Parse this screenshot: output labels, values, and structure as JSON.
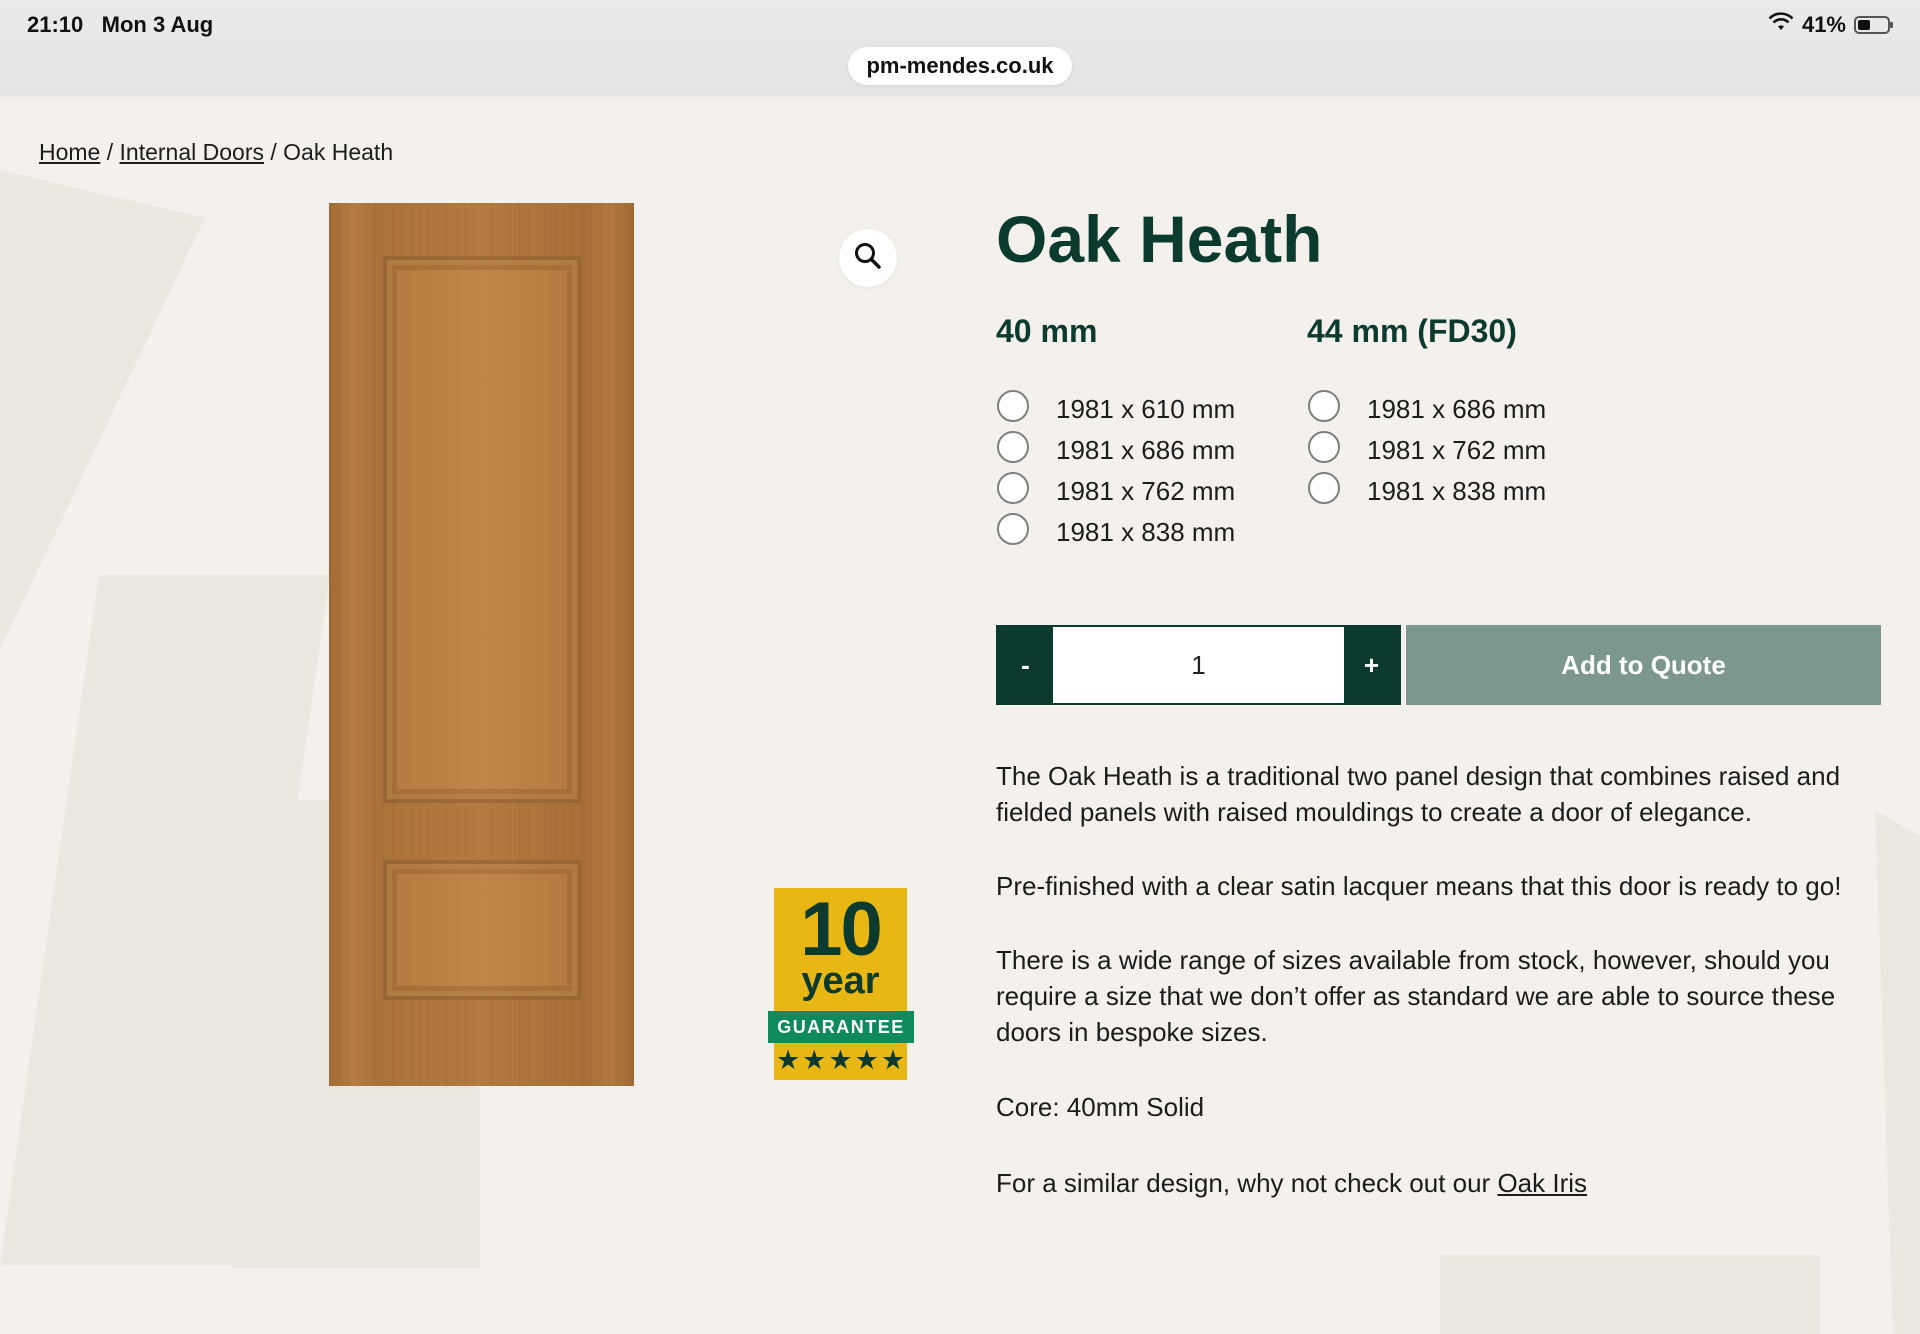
{
  "status_bar": {
    "time": "21:10",
    "date": "Mon 3 Aug",
    "battery": "41%",
    "url": "pm-mendes.co.uk"
  },
  "breadcrumb": {
    "home": "Home",
    "sep1": "/",
    "category": "Internal Doors",
    "sep2": "/",
    "current": "Oak Heath"
  },
  "product": {
    "title": "Oak Heath",
    "option_groups": [
      {
        "heading": "40 mm",
        "options": [
          "1981 x 610 mm",
          "1981 x 686 mm",
          "1981 x 762 mm",
          "1981 x 838 mm"
        ]
      },
      {
        "heading": "44 mm (FD30)",
        "options": [
          "1981 x 686 mm",
          "1981 x 762 mm",
          "1981 x 838 mm"
        ]
      }
    ],
    "quantity": {
      "minus": "-",
      "value": "1",
      "plus": "+"
    },
    "add_to_quote": "Add to Quote",
    "description": {
      "p1": "The Oak Heath is a traditional two panel design that combines raised and fielded panels with raised mouldings to create a door of elegance.",
      "p2": "Pre-finished with a clear satin lacquer means that this door is ready to go!",
      "p3": "There is a wide range of sizes available from stock, however, should you require a size that we don’t offer as standard we are able to source these doors in bespoke sizes.",
      "p4": "Core: 40mm Solid",
      "p5_prefix": "For a similar design, why not check out our ",
      "p5_link": "Oak Iris"
    }
  },
  "badge": {
    "number": "10",
    "unit": "year",
    "label": "GUARANTEE",
    "stars": 5
  },
  "icons": {
    "zoom": "magnifier-icon",
    "wifi": "wifi-icon",
    "battery": "battery-icon"
  },
  "colors": {
    "brand_green": "#0b3a2e",
    "add_button": "#7b9790",
    "badge_yellow": "#e8b714",
    "badge_green": "#0e8a5c",
    "page_bg": "#f4f1ec"
  }
}
